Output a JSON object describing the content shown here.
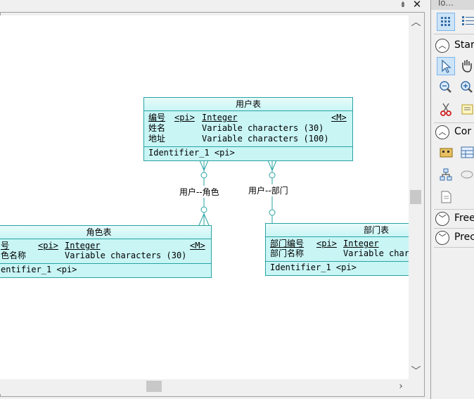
{
  "window": {
    "pin_glyph": "⇟",
    "close_glyph": "✕"
  },
  "entities": {
    "user": {
      "title": "用户表",
      "attributes": [
        {
          "name": "编号",
          "key": "<pi>",
          "type": "Integer",
          "flag": "<M>"
        },
        {
          "name": "姓名",
          "key": "",
          "type": "Variable characters (30)",
          "flag": ""
        },
        {
          "name": "地址",
          "key": "",
          "type": "Variable characters (100)",
          "flag": ""
        }
      ],
      "identifier": "Identifier_1  <pi>"
    },
    "role": {
      "title": "角色表",
      "attributes": [
        {
          "name": "号",
          "key": "<pi>",
          "type": "Integer",
          "flag": "<M>"
        },
        {
          "name": "色名称",
          "key": "",
          "type": "Variable characters (30)",
          "flag": ""
        }
      ],
      "identifier": "entifier_1  <pi>"
    },
    "dept": {
      "title": "部门表",
      "attributes": [
        {
          "name": "部门编号",
          "key": "<pi>",
          "type": "Integer",
          "flag": ""
        },
        {
          "name": "部门名称",
          "key": "",
          "type": "Variable chars",
          "flag": ""
        }
      ],
      "identifier": "Identifier_1  <pi>"
    }
  },
  "relations": {
    "user_role": "用户--角色",
    "user_dept": "用户--部门"
  },
  "toolbox": {
    "title": "To...",
    "sections": [
      {
        "label": "Star",
        "expanded": true
      },
      {
        "label": "Cor",
        "expanded": true
      },
      {
        "label": "Free",
        "expanded": false
      },
      {
        "label": "Prec",
        "expanded": false
      }
    ]
  },
  "colors": {
    "entity_fill": "#c9f5f5",
    "entity_border": "#29a3a3",
    "link": "#29a3a3"
  }
}
